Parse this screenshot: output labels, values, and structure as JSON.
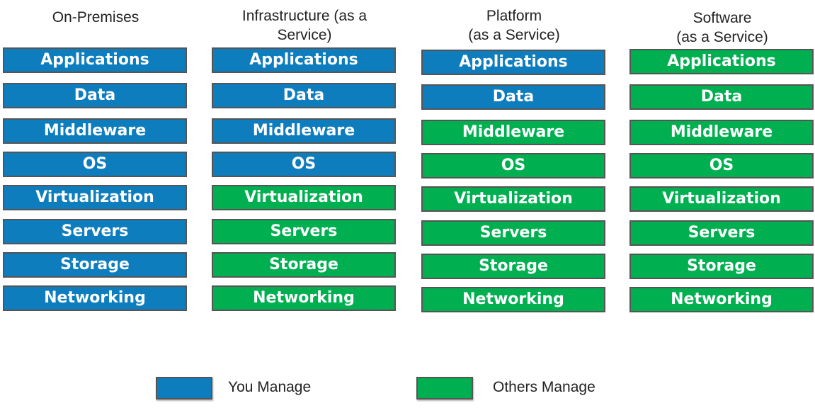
{
  "colors": {
    "you_manage": "#0E7DBE",
    "others_manage": "#00B050"
  },
  "layers": [
    "Applications",
    "Data",
    "Middleware",
    "OS",
    "Virtualization",
    "Servers",
    "Storage",
    "Networking"
  ],
  "columns": [
    {
      "title": "On-Premises",
      "owners": [
        "you",
        "you",
        "you",
        "you",
        "you",
        "you",
        "you",
        "you"
      ]
    },
    {
      "title": "Infrastructure (as a Service)",
      "owners": [
        "you",
        "you",
        "you",
        "you",
        "others",
        "others",
        "others",
        "others"
      ]
    },
    {
      "title": "Platform (as a Service)",
      "owners": [
        "you",
        "you",
        "others",
        "others",
        "others",
        "others",
        "others",
        "others"
      ]
    },
    {
      "title": "Software (as a Service)",
      "owners": [
        "others",
        "others",
        "others",
        "others",
        "others",
        "others",
        "others",
        "others"
      ]
    }
  ],
  "legend": {
    "you_label": "You Manage",
    "others_label": "Others Manage"
  }
}
